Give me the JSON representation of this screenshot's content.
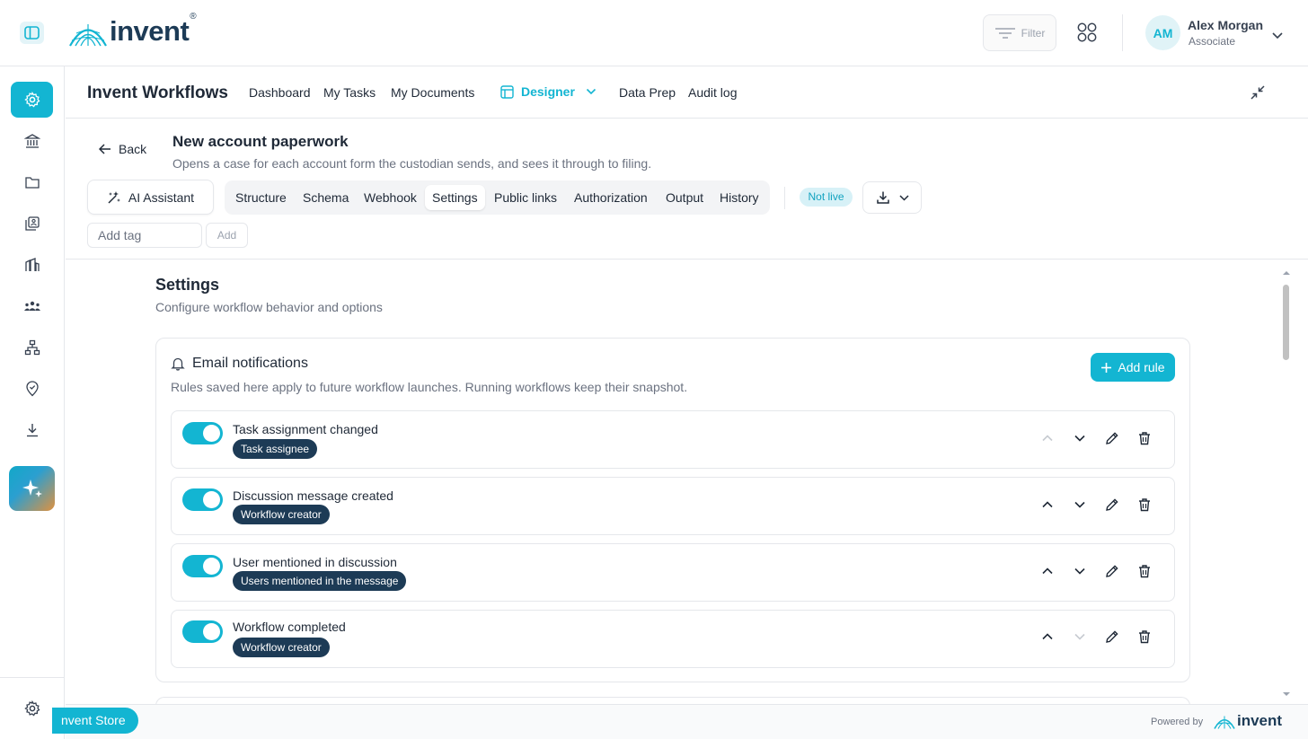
{
  "brand": {
    "logo_text": "invent",
    "registered_mark": "®",
    "accent_color": "#13b5d2",
    "navy_color": "#1d3b56"
  },
  "topbar": {
    "filter_label": "Filter",
    "user": {
      "initials": "AM",
      "name": "Alex Morgan",
      "role": "Associate"
    }
  },
  "leftnav": {
    "items": [
      "settings-icon",
      "bank-icon",
      "folder-icon",
      "library-icon",
      "buildings-icon",
      "team-icon",
      "hierarchy-icon",
      "location-check-icon",
      "download-icon"
    ],
    "active_item": "settings-icon",
    "ai_item": "sparkles-icon",
    "bottom_item": "gear-icon"
  },
  "workflow_header": {
    "title": "Invent Workflows",
    "nav": [
      "Dashboard",
      "My Tasks",
      "My Documents",
      "Designer",
      "Data Prep",
      "Audit log"
    ],
    "active_nav": "Designer"
  },
  "document": {
    "back_label": "Back",
    "title": "New account paperwork",
    "description": "Opens a case for each account form the custodian sends, and sees it through to filing.",
    "ai_assistant_label": "AI Assistant",
    "tabs": [
      "Structure",
      "Schema",
      "Webhook",
      "Settings",
      "Public links",
      "Authorization",
      "Output",
      "History"
    ],
    "active_tab": "Settings",
    "status": "Not live",
    "tag_placeholder": "Add tag",
    "tag_add_label": "Add"
  },
  "settings": {
    "title": "Settings",
    "subtitle": "Configure workflow behavior and options",
    "email_notifications": {
      "title": "Email notifications",
      "description": "Rules saved here apply to future workflow launches. Running workflows keep their snapshot.",
      "add_rule_label": "Add rule",
      "rules": [
        {
          "name": "Task assignment changed",
          "recipient": "Task assignee",
          "enabled": true,
          "can_move_up": false,
          "can_move_down": true
        },
        {
          "name": "Discussion message created",
          "recipient": "Workflow creator",
          "enabled": true,
          "can_move_up": true,
          "can_move_down": true
        },
        {
          "name": "User mentioned in discussion",
          "recipient": "Users mentioned in the message",
          "enabled": true,
          "can_move_up": true,
          "can_move_down": true
        },
        {
          "name": "Workflow completed",
          "recipient": "Workflow creator",
          "enabled": true,
          "can_move_up": true,
          "can_move_down": false
        }
      ]
    }
  },
  "footer": {
    "store_label": "nvent Store",
    "powered_by": "Powered by",
    "powered_logo": "invent"
  }
}
